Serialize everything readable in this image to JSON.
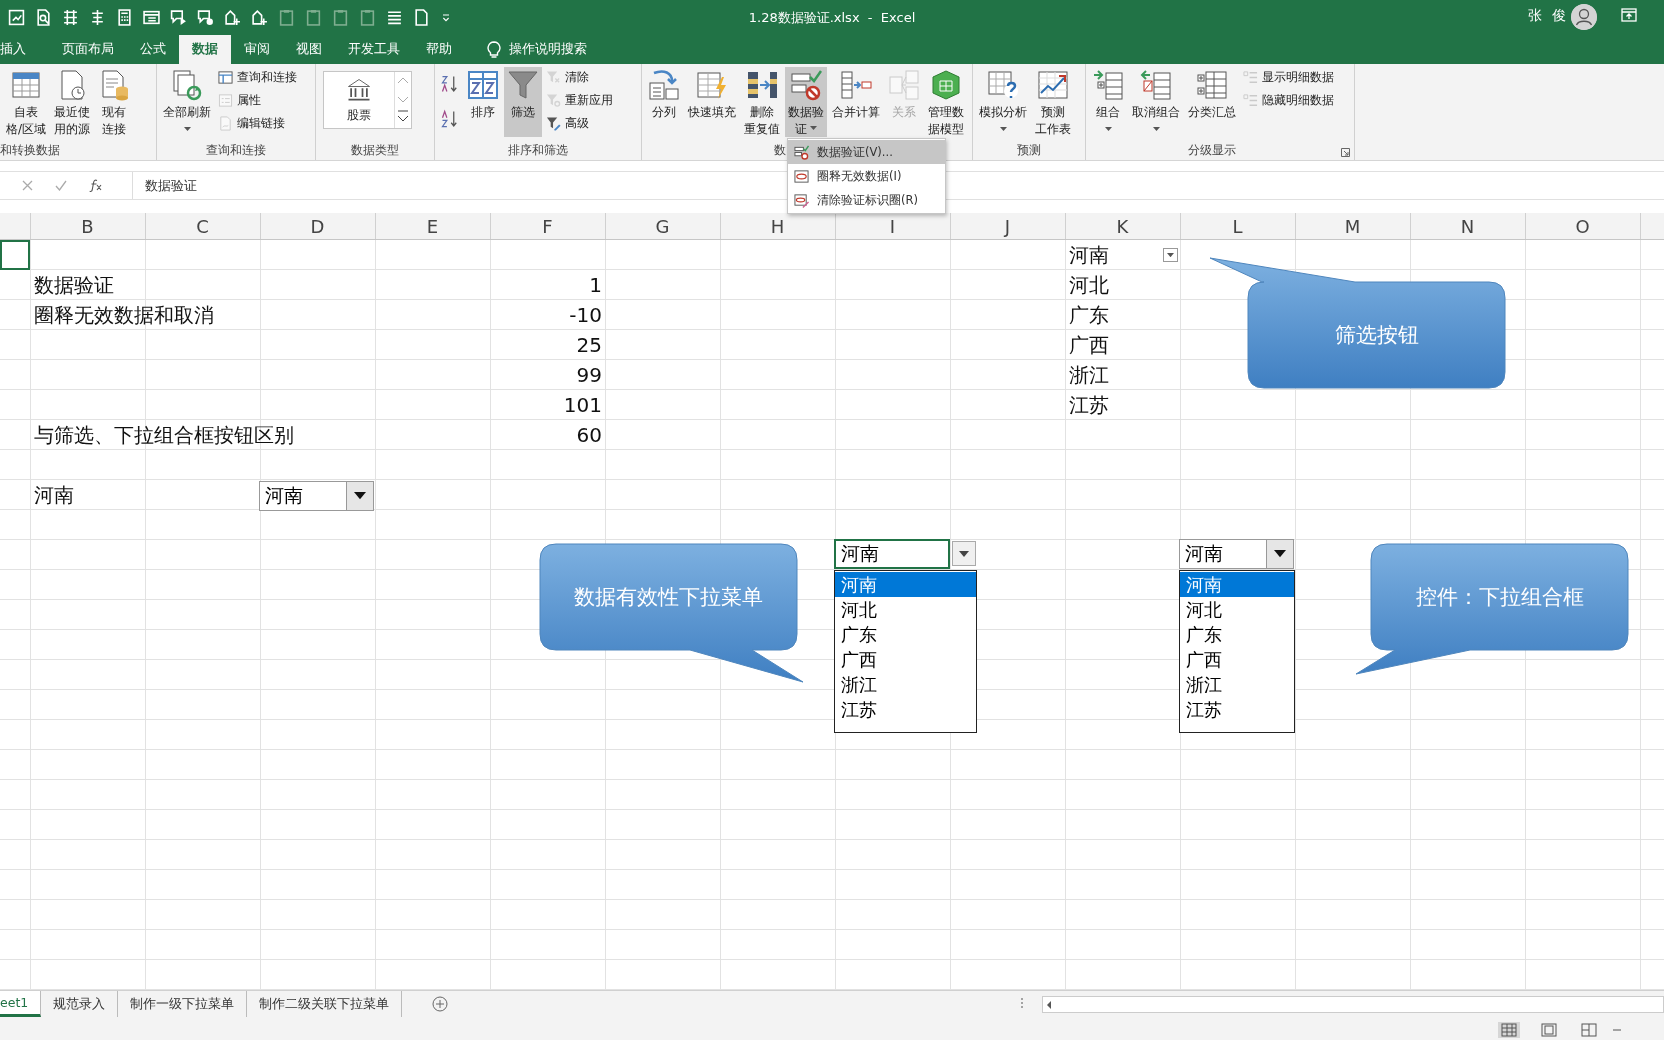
{
  "window": {
    "title": "1.28数据验证.xlsx  -  Excel",
    "user": "张 俊"
  },
  "tabs": [
    {
      "label": "插入",
      "selected": false
    },
    {
      "label": "页面布局",
      "selected": false
    },
    {
      "label": "公式",
      "selected": false
    },
    {
      "label": "数据",
      "selected": true
    },
    {
      "label": "审阅",
      "selected": false
    },
    {
      "label": "视图",
      "selected": false
    },
    {
      "label": "开发工具",
      "selected": false
    },
    {
      "label": "帮助",
      "selected": false
    }
  ],
  "search": {
    "label": "操作说明搜索"
  },
  "ribbon": {
    "groups": [
      {
        "label": "和转换数据",
        "buttons": [
          {
            "kind": "large",
            "lines": [
              "自表",
              "格/区域"
            ],
            "pressed": false,
            "disabled": false,
            "dropdown": false
          },
          {
            "kind": "large",
            "lines": [
              "最近使",
              "用的源"
            ],
            "pressed": false,
            "disabled": false,
            "dropdown": false
          },
          {
            "kind": "large",
            "lines": [
              "现有",
              "连接"
            ],
            "pressed": false,
            "disabled": false,
            "dropdown": false
          }
        ]
      },
      {
        "label": "查询和连接",
        "buttons": [
          {
            "kind": "large",
            "lines": [
              "全部刷新"
            ],
            "pressed": false,
            "disabled": false,
            "dropdown": true
          },
          {
            "kind": "small",
            "lines": [
              "查询和连接"
            ],
            "disabled": false
          },
          {
            "kind": "small",
            "lines": [
              "属性"
            ],
            "disabled": true
          },
          {
            "kind": "small",
            "lines": [
              "编辑链接"
            ],
            "disabled": true
          }
        ]
      },
      {
        "label": "数据类型",
        "buttons": [
          {
            "kind": "gallery",
            "lines": [
              "股票"
            ]
          }
        ]
      },
      {
        "label": "排序和筛选",
        "buttons": [
          {
            "kind": "icon",
            "disabled": false
          },
          {
            "kind": "icon",
            "disabled": false
          },
          {
            "kind": "large",
            "lines": [
              "排序"
            ],
            "pressed": false,
            "disabled": false,
            "dropdown": false
          },
          {
            "kind": "large",
            "lines": [
              "筛选"
            ],
            "pressed": true,
            "disabled": false,
            "dropdown": false
          },
          {
            "kind": "small",
            "lines": [
              "清除"
            ],
            "disabled": true
          },
          {
            "kind": "small",
            "lines": [
              "重新应用"
            ],
            "disabled": true
          },
          {
            "kind": "small",
            "lines": [
              "高级"
            ],
            "disabled": false
          }
        ]
      },
      {
        "label": "数",
        "buttons": [
          {
            "kind": "large",
            "lines": [
              "分列"
            ],
            "pressed": false,
            "disabled": false,
            "dropdown": false
          },
          {
            "kind": "large",
            "lines": [
              "快速填充"
            ],
            "pressed": false,
            "disabled": false,
            "dropdown": false
          },
          {
            "kind": "large",
            "lines": [
              "删除",
              "重复值"
            ],
            "pressed": false,
            "disabled": false,
            "dropdown": false
          },
          {
            "kind": "large",
            "lines": [
              "数据验",
              "证"
            ],
            "pressed": true,
            "disabled": false,
            "dropdown": true
          },
          {
            "kind": "large",
            "lines": [
              "合并计算"
            ],
            "pressed": false,
            "disabled": false,
            "dropdown": false
          },
          {
            "kind": "large",
            "lines": [
              "关系"
            ],
            "pressed": false,
            "disabled": true,
            "dropdown": false
          },
          {
            "kind": "large",
            "lines": [
              "管理数",
              "据模型"
            ],
            "pressed": false,
            "disabled": false,
            "dropdown": false
          }
        ]
      },
      {
        "label": "预测",
        "buttons": [
          {
            "kind": "large",
            "lines": [
              "模拟分析"
            ],
            "pressed": false,
            "disabled": false,
            "dropdown": true
          },
          {
            "kind": "large",
            "lines": [
              "预测",
              "工作表"
            ],
            "pressed": false,
            "disabled": false,
            "dropdown": false
          }
        ]
      },
      {
        "label": "分级显示",
        "buttons": [
          {
            "kind": "large",
            "lines": [
              "组合"
            ],
            "pressed": false,
            "disabled": false,
            "dropdown": true
          },
          {
            "kind": "large",
            "lines": [
              "取消组合"
            ],
            "pressed": false,
            "disabled": false,
            "dropdown": true
          },
          {
            "kind": "large",
            "lines": [
              "分类汇总"
            ],
            "pressed": false,
            "disabled": false,
            "dropdown": false
          },
          {
            "kind": "small",
            "lines": [
              "显示明细数据"
            ],
            "disabled": true
          },
          {
            "kind": "small",
            "lines": [
              "隐藏明细数据"
            ],
            "disabled": true
          }
        ]
      }
    ]
  },
  "menu": {
    "items": [
      {
        "label": "数据验证(V)...",
        "selected": true
      },
      {
        "label": "圈释无效数据(I)",
        "selected": false
      },
      {
        "label": "清除验证标识圈(R)",
        "selected": false
      }
    ]
  },
  "formula_bar": {
    "content": "数据验证"
  },
  "columns": [
    "B",
    "C",
    "D",
    "E",
    "F",
    "G",
    "H",
    "I",
    "J",
    "K",
    "L",
    "M",
    "N",
    "O"
  ],
  "rows": [
    {
      "A": {
        "selected": true
      },
      "K": {
        "value": "河南",
        "kind": "text",
        "selected": false,
        "filter_button": true
      }
    },
    {
      "B": {
        "value": "数据验证",
        "kind": "text",
        "selected": false
      },
      "F": {
        "value": "1",
        "kind": "number",
        "selected": false
      },
      "K": {
        "value": "河北",
        "kind": "text",
        "selected": false
      }
    },
    {
      "B": {
        "value": "圈释无效数据和取消",
        "kind": "text",
        "selected": false
      },
      "F": {
        "value": "-10",
        "kind": "number",
        "selected": false
      },
      "K": {
        "value": "广东",
        "kind": "text",
        "selected": false
      }
    },
    {
      "F": {
        "value": "25",
        "kind": "number",
        "selected": false
      },
      "K": {
        "value": "广西",
        "kind": "text",
        "selected": false
      }
    },
    {
      "F": {
        "value": "99",
        "kind": "number",
        "selected": false
      },
      "K": {
        "value": "浙江",
        "kind": "text",
        "selected": false
      }
    },
    {
      "F": {
        "value": "101",
        "kind": "number",
        "selected": false
      },
      "K": {
        "value": "江苏",
        "kind": "text",
        "selected": false
      }
    },
    {
      "B": {
        "value": "与筛选、下拉组合框按钮区别",
        "kind": "text",
        "selected": false
      },
      "F": {
        "value": "60",
        "kind": "number",
        "selected": false
      }
    },
    {},
    {
      "B": {
        "value": "河南",
        "kind": "text",
        "selected": false
      }
    }
  ],
  "controls": [
    {
      "kind": "form-combo",
      "value": "河南"
    },
    {
      "kind": "validation-dropdown",
      "value": "河南",
      "items": [
        {
          "label": "河南",
          "selected": true
        },
        {
          "label": "河北",
          "selected": false
        },
        {
          "label": "广东",
          "selected": false
        },
        {
          "label": "广西",
          "selected": false
        },
        {
          "label": "浙江",
          "selected": false
        },
        {
          "label": "江苏",
          "selected": false
        }
      ]
    },
    {
      "kind": "control-dropdown",
      "value": "河南",
      "items": [
        {
          "label": "河南",
          "selected": true
        },
        {
          "label": "河北",
          "selected": false
        },
        {
          "label": "广东",
          "selected": false
        },
        {
          "label": "广西",
          "selected": false
        },
        {
          "label": "浙江",
          "selected": false
        },
        {
          "label": "江苏",
          "selected": false
        }
      ]
    }
  ],
  "callouts": [
    {
      "text": "筛选按钮"
    },
    {
      "text": "数据有效性下拉菜单"
    },
    {
      "text": "控件：下拉组合框"
    }
  ],
  "sheet_tabs": [
    {
      "label": "eet1",
      "selected": true
    },
    {
      "label": "规范录入",
      "selected": false
    },
    {
      "label": "制作一级下拉菜单",
      "selected": false
    },
    {
      "label": "制作二级关联下拉菜单",
      "selected": false
    }
  ]
}
